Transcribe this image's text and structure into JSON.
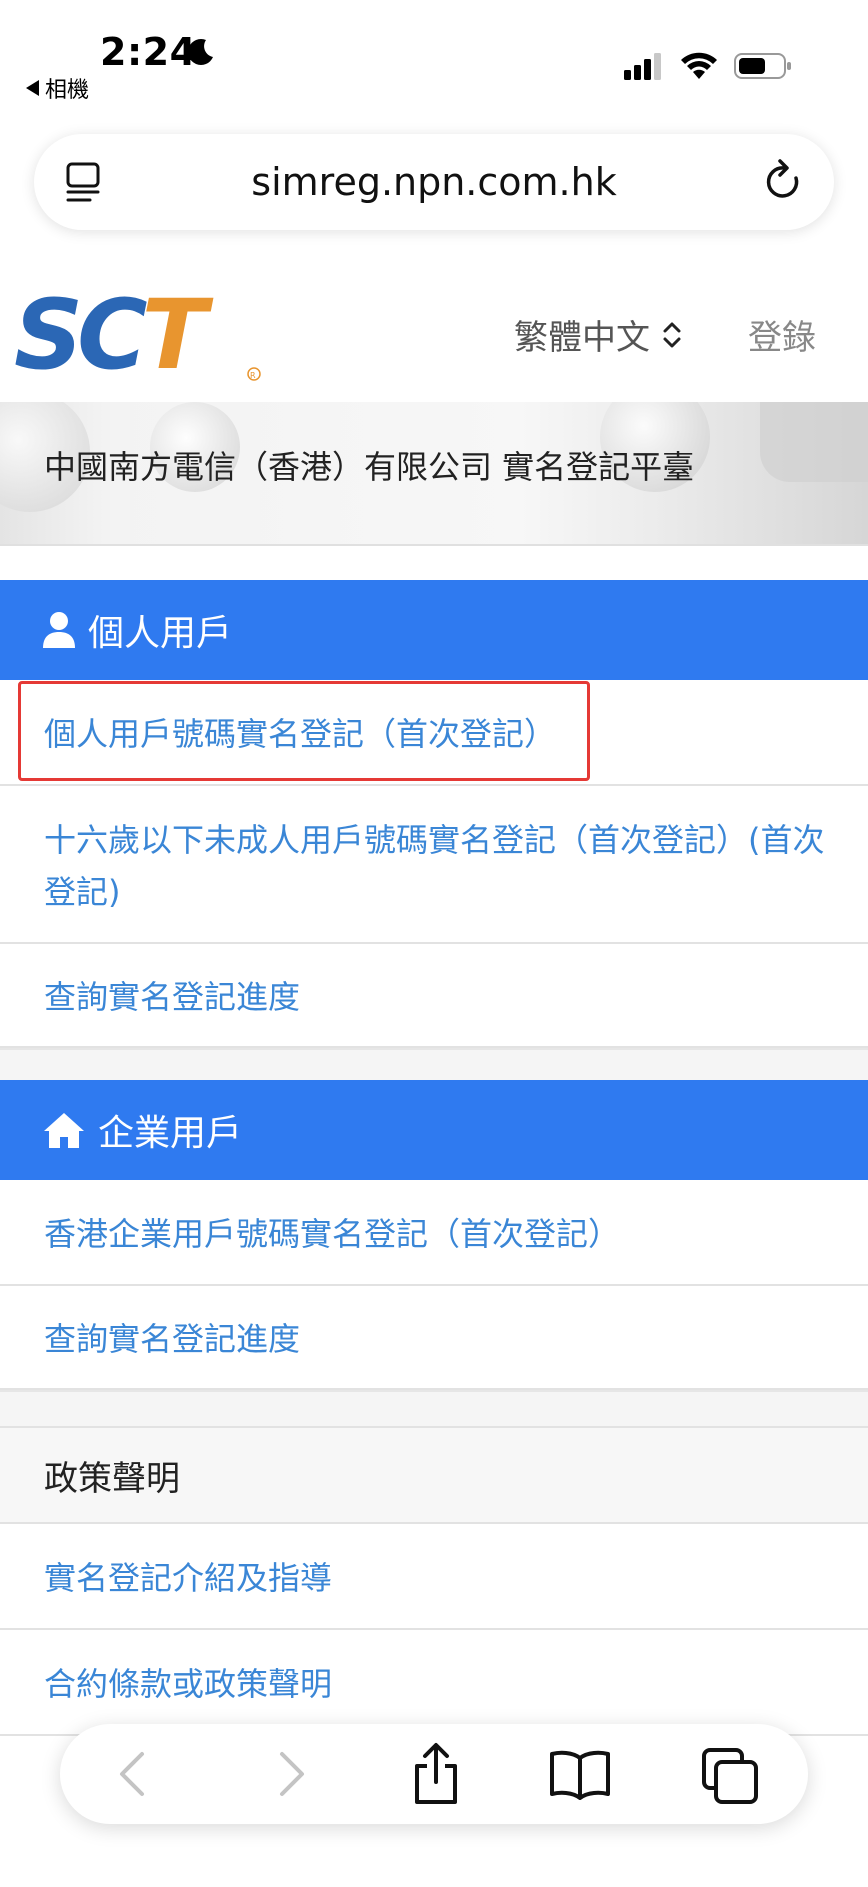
{
  "status_bar": {
    "time": "2:24",
    "back_app": "相機"
  },
  "browser": {
    "url": "simreg.npn.com.hk"
  },
  "site_header": {
    "logo_text": "SCT",
    "language": "繁體中文",
    "login": "登錄"
  },
  "banner": {
    "title": "中國南方電信（香港）有限公司 實名登記平臺"
  },
  "personal": {
    "header": "個人用戶",
    "items": [
      "個人用戶號碼實名登記（首次登記）",
      "十六歲以下未成人用戶號碼實名登記（首次登記）(首次登記)",
      "查詢實名登記進度"
    ]
  },
  "enterprise": {
    "header": "企業用戶",
    "items": [
      "香港企業用戶號碼實名登記（首次登記）",
      "查詢實名登記進度"
    ]
  },
  "policy": {
    "header": "政策聲明",
    "items": [
      "實名登記介紹及指導",
      "合約條款或政策聲明"
    ]
  },
  "colors": {
    "section_blue": "#2f7af0",
    "link_blue": "#3a86d6",
    "highlight_red": "#e53935",
    "logo_blue": "#2b67b5",
    "logo_orange": "#e8952f"
  }
}
